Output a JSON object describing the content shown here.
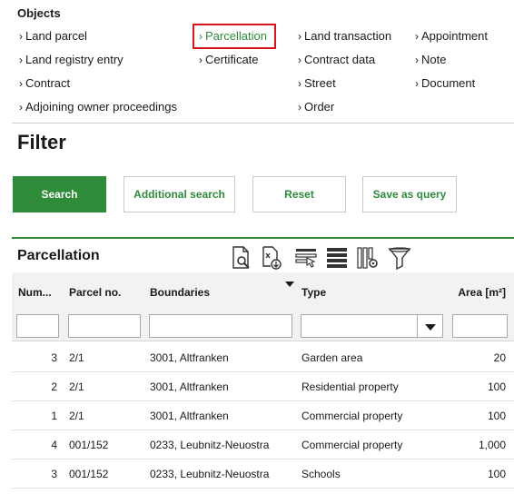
{
  "objects": {
    "title": "Objects",
    "links": [
      {
        "label": "Land parcel"
      },
      {
        "label": "Land registry entry"
      },
      {
        "label": "Contract"
      },
      {
        "label": "Adjoining owner proceedings"
      },
      {
        "label": "Parcellation"
      },
      {
        "label": "Certificate"
      },
      {
        "label": "Land transaction"
      },
      {
        "label": "Contract data"
      },
      {
        "label": "Street"
      },
      {
        "label": "Order"
      },
      {
        "label": "Appointment"
      },
      {
        "label": "Note"
      },
      {
        "label": "Document"
      }
    ]
  },
  "filter": {
    "title": "Filter",
    "search_label": "Search",
    "additional_label": "Additional search",
    "reset_label": "Reset",
    "save_query_label": "Save as query"
  },
  "section": {
    "title": "Parcellation",
    "toolbar_icons": [
      "document-search-icon",
      "export-icon",
      "select-rows-icon",
      "list-view-icon",
      "column-settings-icon",
      "filter-icon"
    ]
  },
  "table": {
    "columns": [
      "Num...",
      "Parcel no.",
      "Boundaries",
      "Type",
      "Area [m²]"
    ],
    "rows": [
      {
        "num": "3",
        "parcel": "2/1",
        "boundaries": "3001, Altfranken",
        "type": "Garden area",
        "area": "20"
      },
      {
        "num": "2",
        "parcel": "2/1",
        "boundaries": "3001, Altfranken",
        "type": "Residential property",
        "area": "100"
      },
      {
        "num": "1",
        "parcel": "2/1",
        "boundaries": "3001, Altfranken",
        "type": "Commercial property",
        "area": "100"
      },
      {
        "num": "4",
        "parcel": "001/152",
        "boundaries": "0233, Leubnitz-Neuostra",
        "type": "Commercial property",
        "area": "1,000"
      },
      {
        "num": "3",
        "parcel": "001/152",
        "boundaries": "0233, Leubnitz-Neuostra",
        "type": "Schools",
        "area": "100"
      }
    ]
  },
  "colors": {
    "accent": "#2e8b3a",
    "highlight": "#d9141b"
  }
}
